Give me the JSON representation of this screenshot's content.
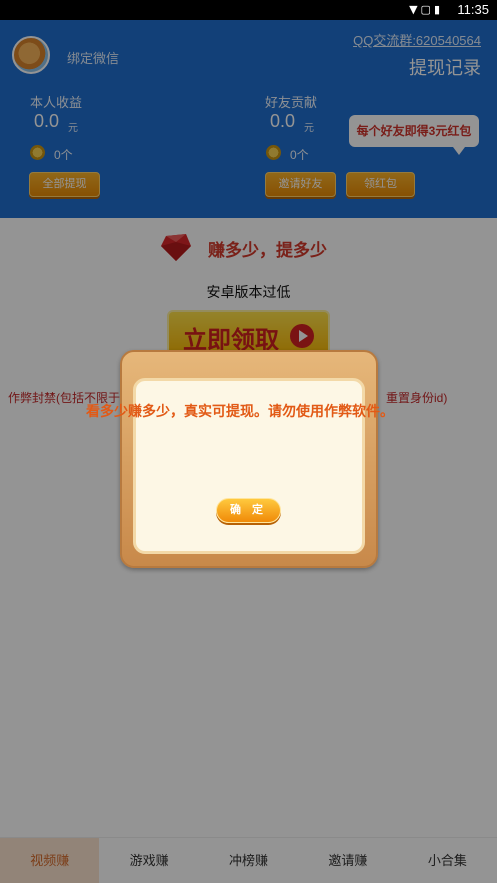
{
  "status_bar": {
    "time": "11:35",
    "icons": [
      "wifi-icon",
      "no-sim-icon",
      "battery-icon"
    ]
  },
  "header": {
    "bind_wechat": "绑定微信",
    "qq_group": "QQ交流群:620540564",
    "withdraw_record": "提现记录",
    "my_earnings": {
      "label": "本人收益",
      "value": "0.0",
      "unit": "元",
      "coins": "0个",
      "button": "全部提现"
    },
    "friend_contribution": {
      "label": "好友贡献",
      "value": "0.0",
      "unit": "元",
      "coins": "0个",
      "invite_button": "邀请好友",
      "red_packet_button": "领红包"
    },
    "bubble": "每个好友即得3元红包"
  },
  "content": {
    "title": "赚多少，提多少",
    "version_notice": "安卓版本过低",
    "claim_button": "立即领取",
    "cheat_left": "作弊封禁(包括不限于",
    "cheat_right": "重置身份id)"
  },
  "dialog": {
    "message": "看多少赚多少，真实可提现。请勿使用作弊软件。",
    "ok": "确 定"
  },
  "tabs": [
    {
      "label": "视频赚",
      "active": true
    },
    {
      "label": "游戏赚",
      "active": false
    },
    {
      "label": "冲榜赚",
      "active": false
    },
    {
      "label": "邀请赚",
      "active": false
    },
    {
      "label": "小合集",
      "active": false
    }
  ],
  "colors": {
    "header_blue": "#1f6fcf",
    "accent_orange": "#f0a01a",
    "title_red": "#d23a2c",
    "dialog_wood": "#d9a264"
  }
}
